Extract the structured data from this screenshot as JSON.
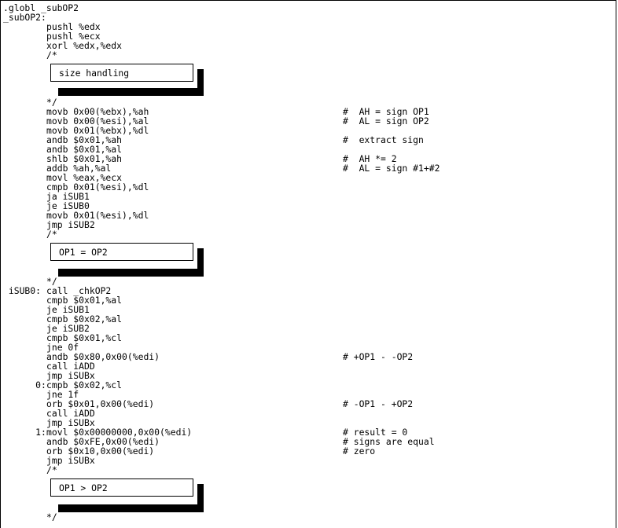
{
  "lines": [
    {
      "label": ".globl _subOP2",
      "code": "",
      "comment": ""
    },
    {
      "label": "_subOP2:",
      "code": "",
      "comment": ""
    },
    {
      "label": "",
      "code": "pushl %edx",
      "comment": ""
    },
    {
      "label": "",
      "code": "pushl %ecx",
      "comment": ""
    },
    {
      "label": "",
      "code": "xorl %edx,%edx",
      "comment": ""
    },
    {
      "label": "",
      "code": "/*",
      "comment": ""
    },
    {
      "label": "",
      "code": "*/",
      "comment": ""
    },
    {
      "label": "",
      "code": "movb 0x00(%ebx),%ah",
      "comment": "#  AH = sign OP1"
    },
    {
      "label": "",
      "code": "movb 0x00(%esi),%al",
      "comment": "#  AL = sign OP2"
    },
    {
      "label": "",
      "code": "movb 0x01(%ebx),%dl",
      "comment": ""
    },
    {
      "label": "",
      "code": "andb $0x01,%ah",
      "comment": "#  extract sign"
    },
    {
      "label": "",
      "code": "andb $0x01,%al",
      "comment": ""
    },
    {
      "label": "",
      "code": "shlb $0x01,%ah",
      "comment": "#  AH *= 2"
    },
    {
      "label": "",
      "code": "addb %ah,%al",
      "comment": "#  AL = sign #1+#2"
    },
    {
      "label": "",
      "code": "movl %eax,%ecx",
      "comment": ""
    },
    {
      "label": "",
      "code": "cmpb 0x01(%esi),%dl",
      "comment": ""
    },
    {
      "label": "",
      "code": "ja iSUB1",
      "comment": ""
    },
    {
      "label": "",
      "code": "je iSUB0",
      "comment": ""
    },
    {
      "label": "",
      "code": "movb 0x01(%esi),%dl",
      "comment": ""
    },
    {
      "label": "",
      "code": "jmp iSUB2",
      "comment": ""
    },
    {
      "label": "",
      "code": "/*",
      "comment": ""
    },
    {
      "label": "",
      "code": "*/",
      "comment": ""
    },
    {
      "label": " iSUB0:",
      "code": "call _chkOP2",
      "comment": ""
    },
    {
      "label": "",
      "code": "cmpb $0x01,%al",
      "comment": ""
    },
    {
      "label": "",
      "code": "je iSUB1",
      "comment": ""
    },
    {
      "label": "",
      "code": "cmpb $0x02,%al",
      "comment": ""
    },
    {
      "label": "",
      "code": "je iSUB2",
      "comment": ""
    },
    {
      "label": "",
      "code": "cmpb $0x01,%cl",
      "comment": ""
    },
    {
      "label": "",
      "code": "jne 0f",
      "comment": ""
    },
    {
      "label": "",
      "code": "andb $0x80,0x00(%edi)",
      "comment": "# +OP1 - -OP2"
    },
    {
      "label": "",
      "code": "call iADD",
      "comment": ""
    },
    {
      "label": "",
      "code": "jmp iSUBx",
      "comment": ""
    },
    {
      "label": "      0:",
      "code": "cmpb $0x02,%cl",
      "comment": ""
    },
    {
      "label": "",
      "code": "jne 1f",
      "comment": ""
    },
    {
      "label": "",
      "code": "orb $0x01,0x00(%edi)",
      "comment": "# -OP1 - +OP2"
    },
    {
      "label": "",
      "code": "call iADD",
      "comment": ""
    },
    {
      "label": "",
      "code": "jmp iSUBx",
      "comment": ""
    },
    {
      "label": "      1:",
      "code": "movl $0x00000000,0x00(%edi)",
      "comment": "# result = 0"
    },
    {
      "label": "",
      "code": "andb $0xFE,0x00(%edi)",
      "comment": "# signs are equal"
    },
    {
      "label": "",
      "code": "orb $0x10,0x00(%edi)",
      "comment": "# zero"
    },
    {
      "label": "",
      "code": "jmp iSUBx",
      "comment": ""
    },
    {
      "label": "",
      "code": "/*",
      "comment": ""
    },
    {
      "label": "",
      "code": "*/",
      "comment": ""
    }
  ],
  "boxes": [
    {
      "text": "size handling"
    },
    {
      "text": "OP1 = OP2"
    },
    {
      "text": "OP1 > OP2"
    }
  ]
}
